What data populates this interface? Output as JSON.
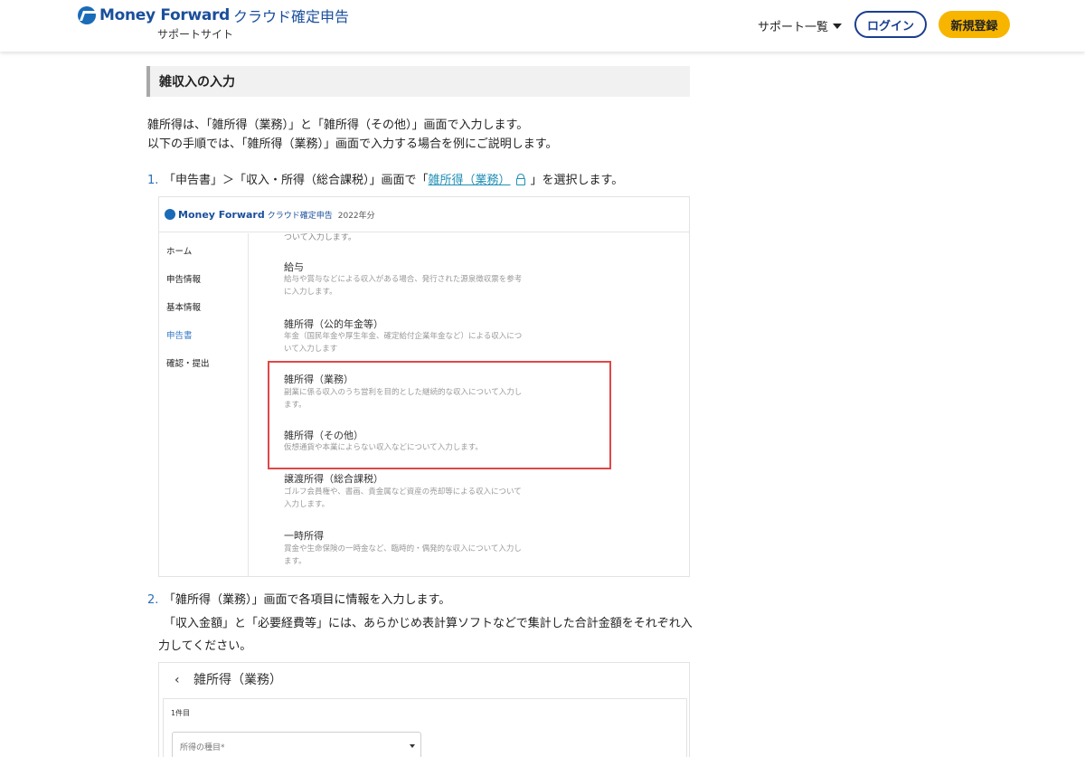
{
  "header": {
    "brand": "Money Forward",
    "product": "クラウド確定申告",
    "subtitle": "サポートサイト",
    "nav_support": "サポート一覧",
    "login_label": "ログイン",
    "register_label": "新規登録"
  },
  "article": {
    "heading": "雑収入の入力",
    "intro_line1": "雑所得は、「雑所得（業務）」と「雑所得（その他）」画面で入力します。",
    "intro_line2": "以下の手順では、「雑所得（業務）」画面で入力する場合を例にご説明します。",
    "step1": {
      "number": "1.",
      "text_before": "「申告書」＞「収入・所得（総合課税）」画面で「",
      "link": "雑所得（業務）",
      "text_after": "」を選択します。"
    },
    "step2": {
      "number": "2.",
      "line1": "「雑所得（業務）」画面で各項目に情報を入力します。",
      "line2": "「収入金額」と「必要経費等」には、あらかじめ表計算ソフトなどで集計した合計金額をそれぞれ入",
      "line3": "力してください。"
    }
  },
  "screenshot1": {
    "brand": "Money Forward",
    "product": "クラウド確定申告",
    "year": "2022年分",
    "sidebar": [
      "ホーム",
      "申告情報",
      "基本情報",
      "申告書",
      "確認・提出"
    ],
    "sidebar_active_index": 3,
    "cut_text": "ついて入力します。",
    "entries": [
      {
        "title": "給与",
        "desc_line1": "給与や賞与などによる収入がある場合、発行された源泉徴収票を参考",
        "desc_line2": "に入力します。"
      },
      {
        "title": "雑所得（公的年金等）",
        "desc_line1": "年金（国民年金や厚生年金、確定給付企業年金など）による収入につ",
        "desc_line2": "いて入力します"
      },
      {
        "title": "雑所得（業務）",
        "desc_line1": "副業に係る収入のうち営利を目的とした継続的な収入について入力し",
        "desc_line2": "ます。"
      },
      {
        "title": "雑所得（その他）",
        "desc_line1": "仮想通貨や本業によらない収入などについて入力します。",
        "desc_line2": ""
      },
      {
        "title": "譲渡所得（総合課税）",
        "desc_line1": "ゴルフ会員権や、書画、貴金属など資産の売却等による収入について",
        "desc_line2": "入力します。"
      },
      {
        "title": "一時所得",
        "desc_line1": "賞金や生命保険の一時金など、臨時的・偶発的な収入について入力し",
        "desc_line2": "ます。"
      }
    ]
  },
  "screenshot2": {
    "back_glyph": "‹",
    "title": "雑所得（業務）",
    "card_label": "1件目",
    "select_placeholder": "所得の種目*"
  },
  "colors": {
    "brand_blue": "#1a4f9c",
    "login_border": "#1a3f8f",
    "register_bg": "#f7b500",
    "link": "#1f8fb5",
    "step_number": "#2b6fb6",
    "highlight_border": "#e04747",
    "active_sidebar": "#3a7bc8"
  }
}
